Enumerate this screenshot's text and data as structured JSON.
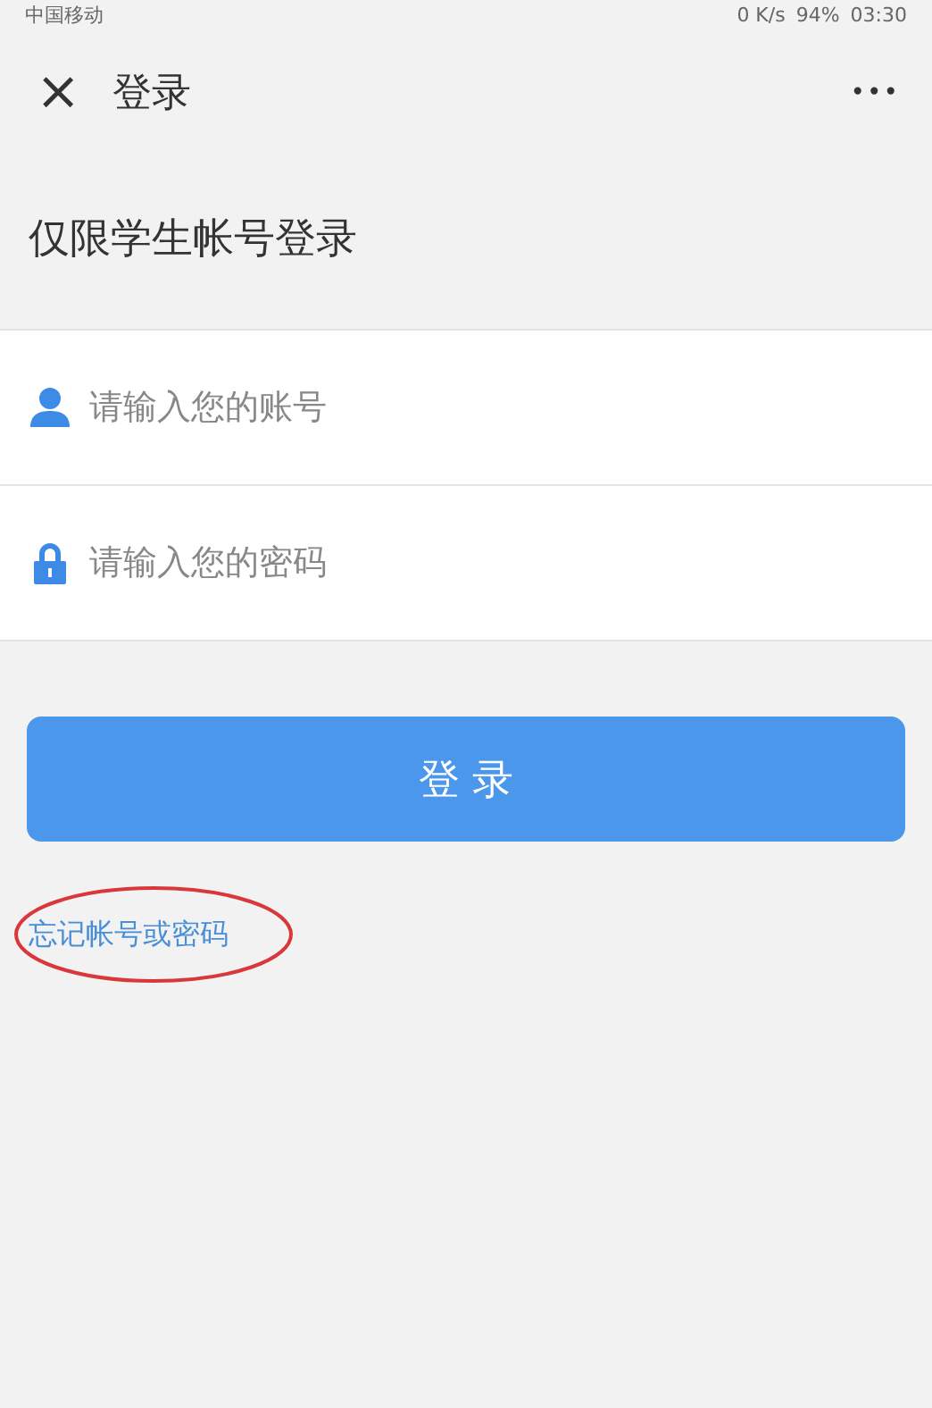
{
  "status_bar": {
    "carrier": "中国移动",
    "speed": "0 K/s",
    "battery": "94%",
    "time": "03:30"
  },
  "nav_bar": {
    "close": "×",
    "title": "登录",
    "more": "•••"
  },
  "heading": "仅限学生帐号登录",
  "fields": [
    {
      "kind": "user",
      "placeholder": "请输入您的账号"
    },
    {
      "kind": "lock",
      "placeholder": "请输入您的密码"
    }
  ],
  "login_button": "登 录",
  "forgot_link": "忘记帐号或密码",
  "annotation": {
    "kind": "ellipse",
    "color": "#d9383a"
  }
}
